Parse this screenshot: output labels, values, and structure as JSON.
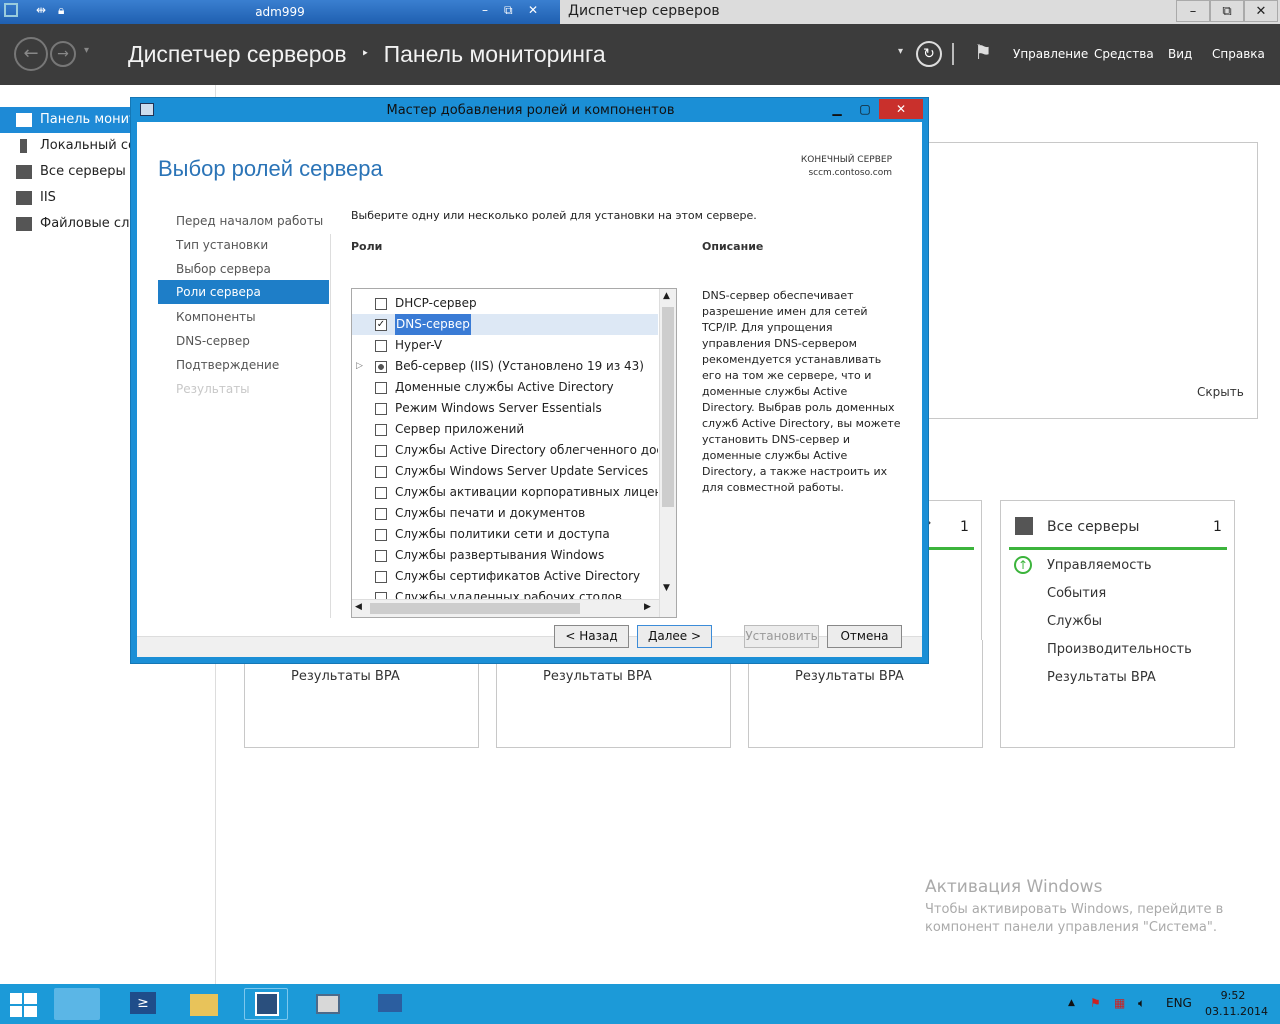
{
  "rdp": {
    "title": "adm999"
  },
  "app_window": {
    "title": "Диспетчер серверов"
  },
  "header": {
    "crumb_root": "Диспетчер серверов",
    "crumb_sep": "‣",
    "crumb_page": "Панель мониторинга",
    "menus": [
      "Управление",
      "Средства",
      "Вид",
      "Справка"
    ]
  },
  "sidebar": {
    "items": [
      {
        "label": "Панель мониторинга",
        "icon": "dashboard-icon"
      },
      {
        "label": "Локальный сервер",
        "icon": "server-icon"
      },
      {
        "label": "Все серверы",
        "icon": "servers-icon"
      },
      {
        "label": "IIS",
        "icon": "iis-icon"
      },
      {
        "label": "Файловые службы и службы хранилища",
        "icon": "file-services-icon"
      }
    ]
  },
  "dashboard": {
    "hide_label": "Скрыть",
    "tile_count_partial": "1",
    "all_servers": {
      "title": "Все серверы",
      "count": "1",
      "items": [
        "Управляемость",
        "События",
        "Службы",
        "Производительность",
        "Результаты BPA"
      ]
    },
    "bpa_label": "Результаты BPA"
  },
  "dialog": {
    "title": "Мастер добавления ролей и компонентов",
    "page_title": "Выбор ролей сервера",
    "dest_label": "КОНЕЧНЫЙ СЕРВЕР",
    "dest_server": "sccm.contoso.com",
    "steps": [
      "Перед началом работы",
      "Тип установки",
      "Выбор сервера",
      "Роли сервера",
      "Компоненты",
      "DNS-сервер",
      "Подтверждение",
      "Результаты"
    ],
    "instruction": "Выберите одну или несколько ролей для установки на этом сервере.",
    "roles_header": "Роли",
    "description_header": "Описание",
    "roles": [
      {
        "label": "DHCP-сервер",
        "state": "unchecked"
      },
      {
        "label": "DNS-сервер",
        "state": "checked"
      },
      {
        "label": "Hyper-V",
        "state": "unchecked"
      },
      {
        "label": "Веб-сервер (IIS) (Установлено 19 из 43)",
        "state": "partial"
      },
      {
        "label": "Доменные службы Active Directory",
        "state": "unchecked"
      },
      {
        "label": "Режим Windows Server Essentials",
        "state": "unchecked"
      },
      {
        "label": "Сервер приложений",
        "state": "unchecked"
      },
      {
        "label": "Службы Active Directory облегченного доступа к каталогам",
        "state": "unchecked"
      },
      {
        "label": "Службы Windows Server Update Services",
        "state": "unchecked"
      },
      {
        "label": "Службы активации корпоративных лицензий",
        "state": "unchecked"
      },
      {
        "label": "Службы печати и документов",
        "state": "unchecked"
      },
      {
        "label": "Службы политики сети и доступа",
        "state": "unchecked"
      },
      {
        "label": "Службы развертывания Windows",
        "state": "unchecked"
      },
      {
        "label": "Службы сертификатов Active Directory",
        "state": "unchecked"
      },
      {
        "label": "Службы удаленных рабочих столов",
        "state": "unchecked"
      }
    ],
    "description": "DNS-сервер обеспечивает разрешение имен для сетей TCP/IP. Для упрощения управления DNS-сервером рекомендуется устанавливать его на том же сервере, что и доменные службы Active Directory. Выбрав роль доменных служб Active Directory, вы можете установить DNS-сервер и доменные службы Active Directory, а также настроить их для совместной работы.",
    "buttons": {
      "back": "< Назад",
      "next": "Далее >",
      "install": "Установить",
      "cancel": "Отмена"
    }
  },
  "activation": {
    "title": "Активация Windows",
    "line1": "Чтобы активировать Windows, перейдите в",
    "line2": "компонент панели управления \"Система\"."
  },
  "taskbar": {
    "lang": "ENG",
    "time": "9:52",
    "date": "03.11.2014",
    "apps": [
      "start-icon",
      "server-manager-icon",
      "powershell-icon",
      "explorer-icon",
      "rdp-icon",
      "computer-icon",
      "network-icon"
    ]
  }
}
